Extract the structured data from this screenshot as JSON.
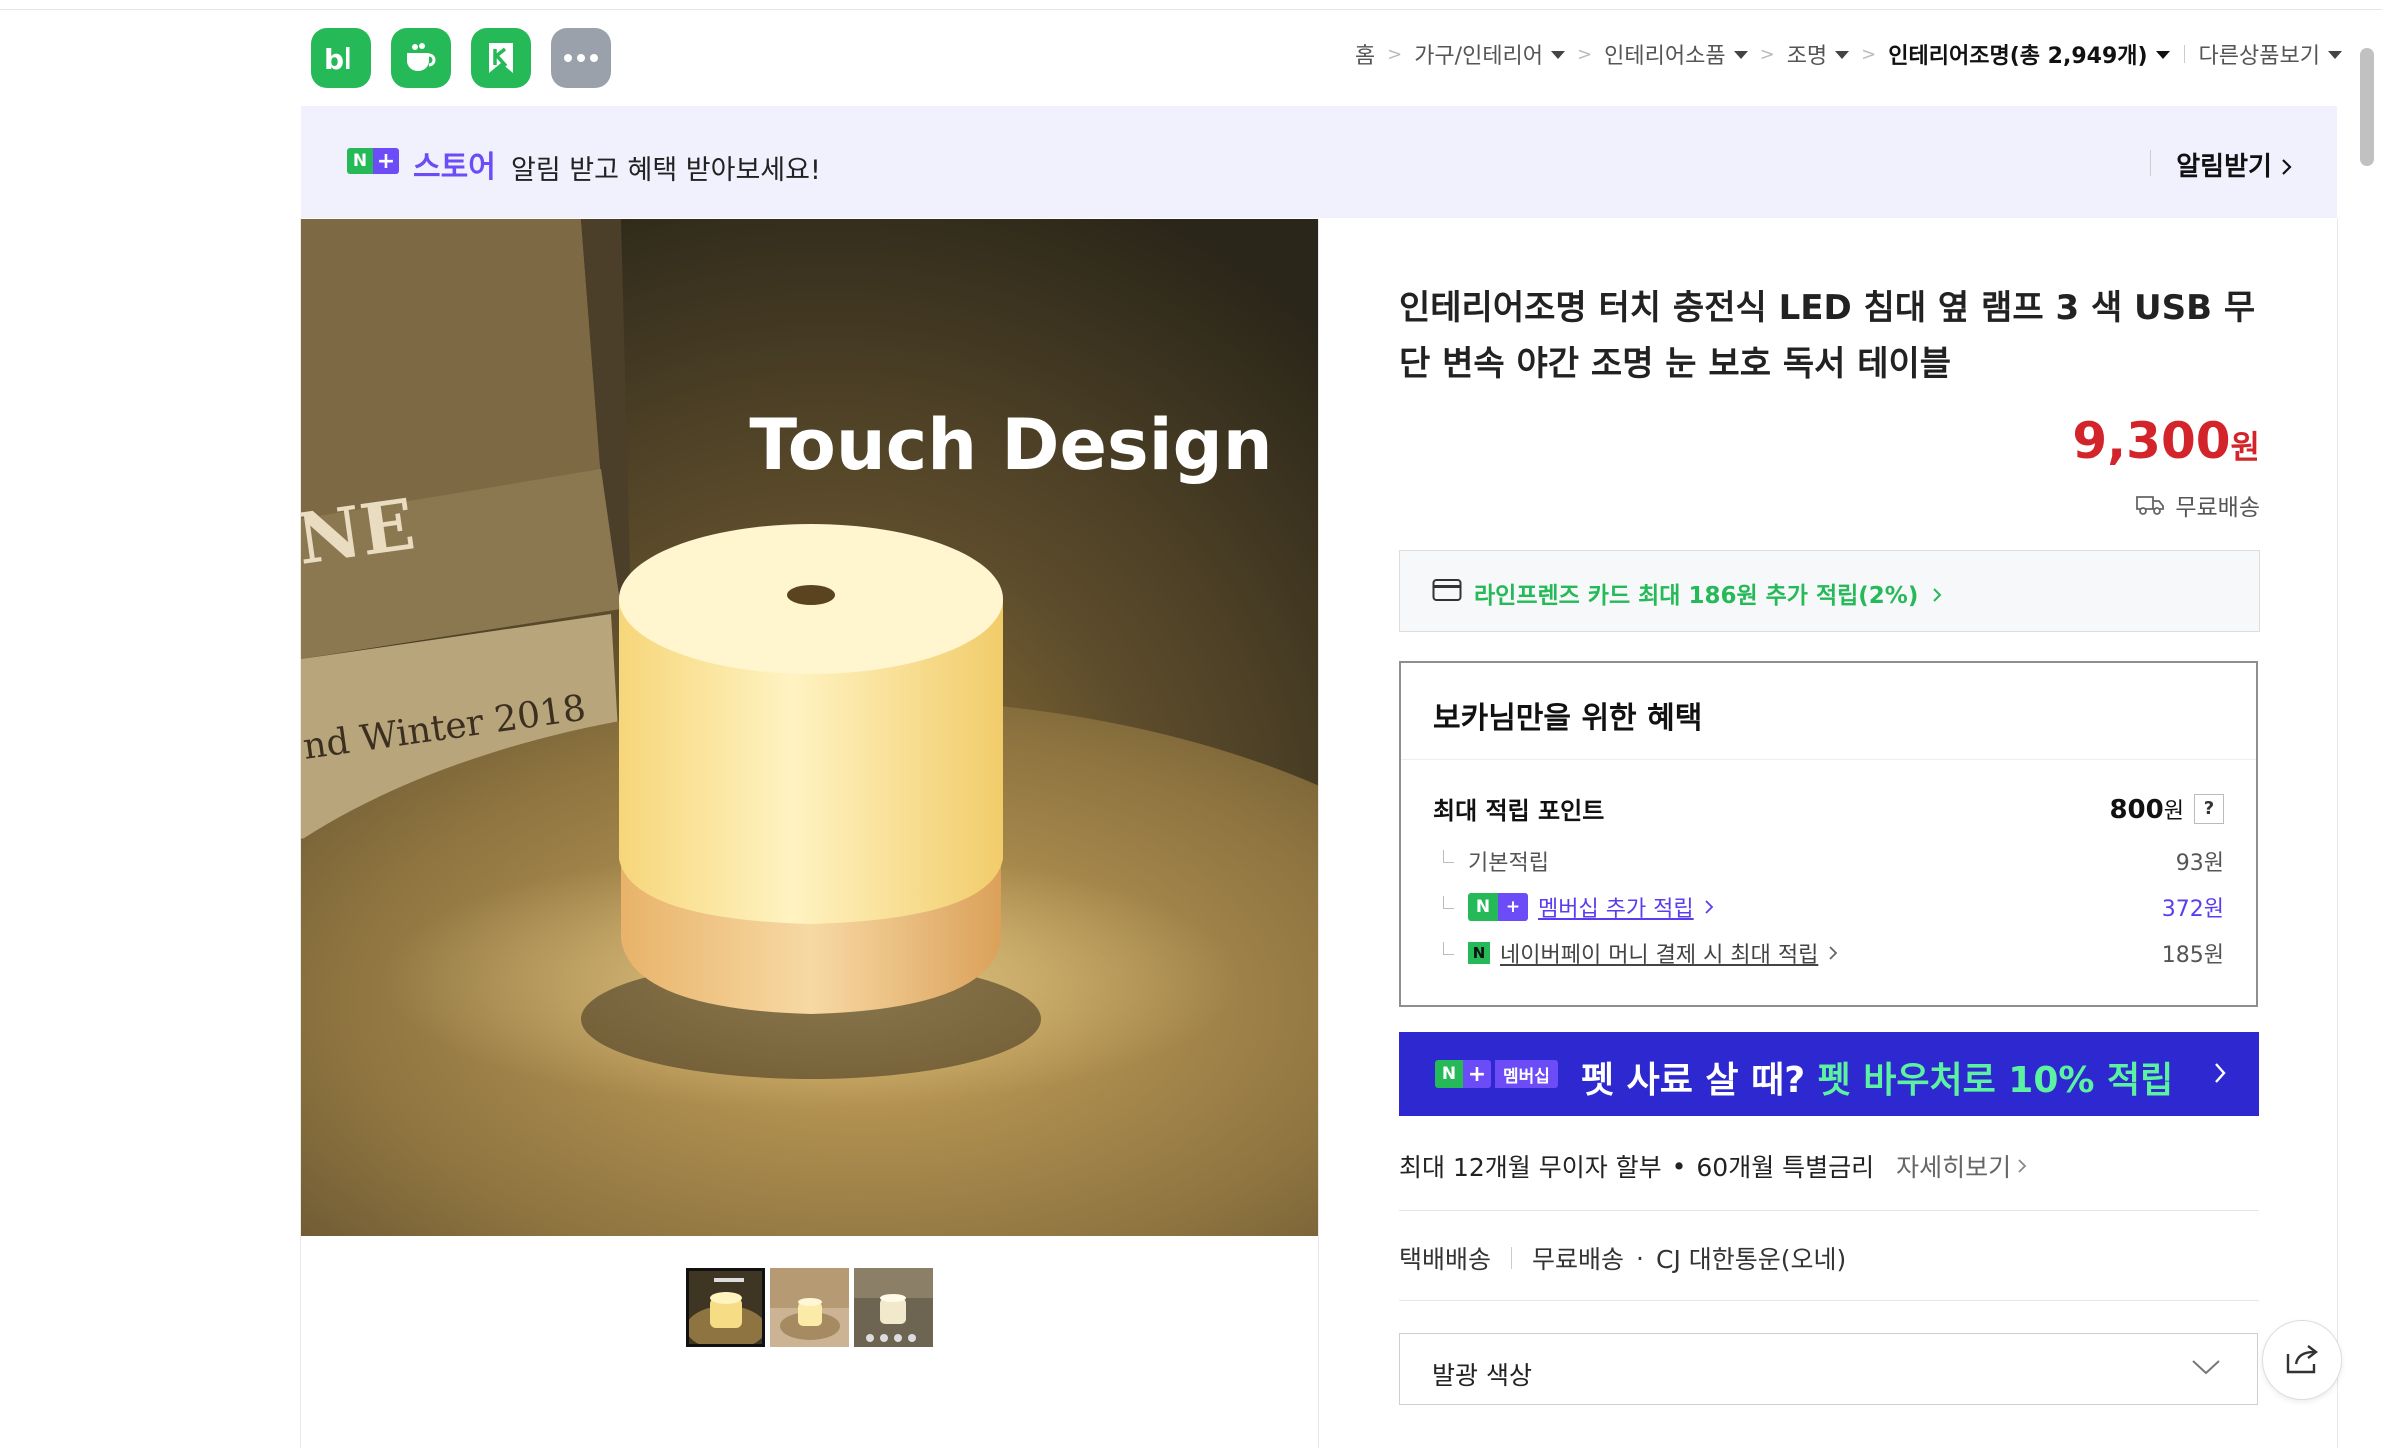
{
  "apps": [
    {
      "name": "blog",
      "icon": "blog-icon",
      "color": "#25b957"
    },
    {
      "name": "cafe",
      "icon": "cafe-cup-icon",
      "color": "#25b957"
    },
    {
      "name": "bookmark",
      "icon": "bookmark-k-icon",
      "color": "#25b957"
    },
    {
      "name": "more",
      "icon": "more-dots-icon",
      "color": "#9aa1ab"
    }
  ],
  "breadcrumb": {
    "home": "홈",
    "level1": "가구/인테리어",
    "level2": "인테리어소품",
    "level3": "조명",
    "current": "인테리어조명(총 2,949개)",
    "other": "다른상품보기"
  },
  "banner": {
    "n_badge": "N",
    "plus_badge": "+",
    "store": "스토어",
    "message": "알림 받고 혜택 받아보세요!",
    "notify": "알림받기"
  },
  "product": {
    "image_caption": "Touch Design",
    "image_book_text_1": "NE",
    "image_book_text_2": "nd Winter 2018",
    "title": "인테리어조명 터치 충전식 LED 침대 옆 램프 3 색 USB 무단 변속 야간 조명 눈 보호 독서 테이블",
    "price": "9,300",
    "currency": "원",
    "shipping": "무료배송",
    "thumbnail_count": 3,
    "selected_thumbnail": 1
  },
  "card_offer": {
    "text": "라인프렌즈 카드 최대 186원 추가 적립(2%)"
  },
  "benefit": {
    "header": "보카님만을 위한 혜택",
    "max_points_label": "최대 적립 포인트",
    "max_points_value": "800",
    "won": "원",
    "help": "?",
    "basic_label": "기본적립",
    "basic_value": "93원",
    "membership_label": "멤버십 추가 적립",
    "membership_value": "372원",
    "npay_label": "네이버페이 머니 결제 시 최대 적립",
    "npay_value": "185원",
    "npay_badge": "N"
  },
  "promo": {
    "membership_badge": "멤버십",
    "text_main": "펫 사료 살 때?",
    "text_highlight": "펫 바우처로 10% 적립"
  },
  "installment": {
    "text1": "최대 12개월 무이자 할부",
    "dot": "•",
    "text2": "60개월 특별금리",
    "more": "자세히보기"
  },
  "delivery": {
    "type": "택배배송",
    "fee": "무료배송",
    "dot": "·",
    "carrier": "CJ 대한통운(오네)"
  },
  "option_select": {
    "label": "발광 색상"
  },
  "colors": {
    "accent_green": "#25b957",
    "accent_purple": "#6b4cf6",
    "price_red": "#d3242b",
    "promo_blue": "#2d28cf",
    "promo_highlight": "#5cf2a0"
  }
}
